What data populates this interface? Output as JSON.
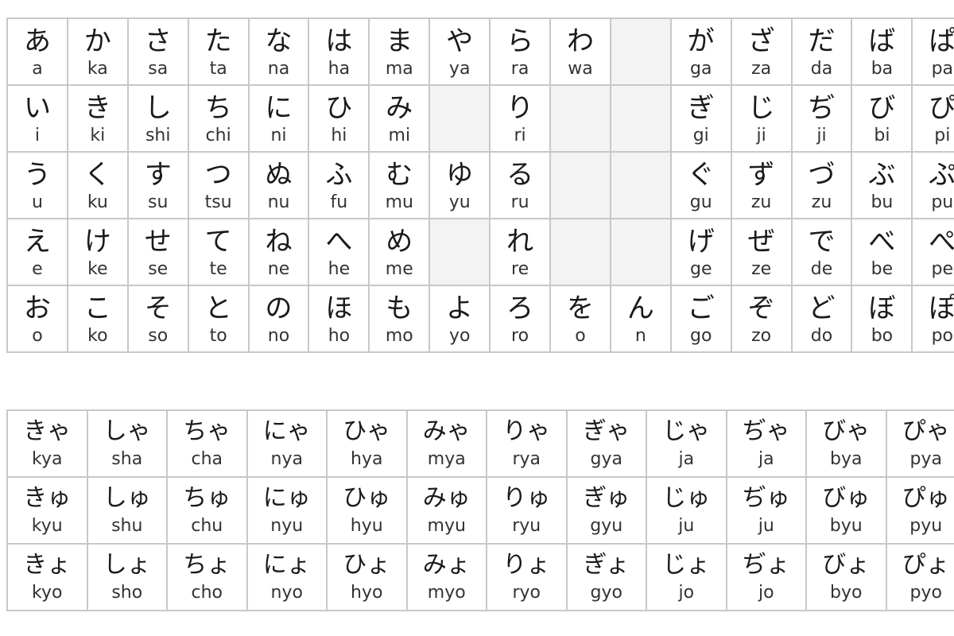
{
  "colors": {
    "border": "#c8c8c8",
    "empty_cell": "#f3f3f3",
    "text": "#222222"
  },
  "basic_table": {
    "rows": [
      [
        [
          "あ",
          "a"
        ],
        [
          "か",
          "ka"
        ],
        [
          "さ",
          "sa"
        ],
        [
          "た",
          "ta"
        ],
        [
          "な",
          "na"
        ],
        [
          "は",
          "ha"
        ],
        [
          "ま",
          "ma"
        ],
        [
          "や",
          "ya"
        ],
        [
          "ら",
          "ra"
        ],
        [
          "わ",
          "wa"
        ],
        null,
        [
          "が",
          "ga"
        ],
        [
          "ざ",
          "za"
        ],
        [
          "だ",
          "da"
        ],
        [
          "ば",
          "ba"
        ],
        [
          "ぱ",
          "pa"
        ]
      ],
      [
        [
          "い",
          "i"
        ],
        [
          "き",
          "ki"
        ],
        [
          "し",
          "shi"
        ],
        [
          "ち",
          "chi"
        ],
        [
          "に",
          "ni"
        ],
        [
          "ひ",
          "hi"
        ],
        [
          "み",
          "mi"
        ],
        null,
        [
          "り",
          "ri"
        ],
        null,
        null,
        [
          "ぎ",
          "gi"
        ],
        [
          "じ",
          "ji"
        ],
        [
          "ぢ",
          "ji"
        ],
        [
          "び",
          "bi"
        ],
        [
          "ぴ",
          "pi"
        ]
      ],
      [
        [
          "う",
          "u"
        ],
        [
          "く",
          "ku"
        ],
        [
          "す",
          "su"
        ],
        [
          "つ",
          "tsu"
        ],
        [
          "ぬ",
          "nu"
        ],
        [
          "ふ",
          "fu"
        ],
        [
          "む",
          "mu"
        ],
        [
          "ゆ",
          "yu"
        ],
        [
          "る",
          "ru"
        ],
        null,
        null,
        [
          "ぐ",
          "gu"
        ],
        [
          "ず",
          "zu"
        ],
        [
          "づ",
          "zu"
        ],
        [
          "ぶ",
          "bu"
        ],
        [
          "ぷ",
          "pu"
        ]
      ],
      [
        [
          "え",
          "e"
        ],
        [
          "け",
          "ke"
        ],
        [
          "せ",
          "se"
        ],
        [
          "て",
          "te"
        ],
        [
          "ね",
          "ne"
        ],
        [
          "へ",
          "he"
        ],
        [
          "め",
          "me"
        ],
        null,
        [
          "れ",
          "re"
        ],
        null,
        null,
        [
          "げ",
          "ge"
        ],
        [
          "ぜ",
          "ze"
        ],
        [
          "で",
          "de"
        ],
        [
          "べ",
          "be"
        ],
        [
          "ぺ",
          "pe"
        ]
      ],
      [
        [
          "お",
          "o"
        ],
        [
          "こ",
          "ko"
        ],
        [
          "そ",
          "so"
        ],
        [
          "と",
          "to"
        ],
        [
          "の",
          "no"
        ],
        [
          "ほ",
          "ho"
        ],
        [
          "も",
          "mo"
        ],
        [
          "よ",
          "yo"
        ],
        [
          "ろ",
          "ro"
        ],
        [
          "を",
          "o"
        ],
        [
          "ん",
          "n"
        ],
        [
          "ご",
          "go"
        ],
        [
          "ぞ",
          "zo"
        ],
        [
          "ど",
          "do"
        ],
        [
          "ぼ",
          "bo"
        ],
        [
          "ぽ",
          "po"
        ]
      ]
    ]
  },
  "combo_table": {
    "rows": [
      [
        [
          "きゃ",
          "kya"
        ],
        [
          "しゃ",
          "sha"
        ],
        [
          "ちゃ",
          "cha"
        ],
        [
          "にゃ",
          "nya"
        ],
        [
          "ひゃ",
          "hya"
        ],
        [
          "みゃ",
          "mya"
        ],
        [
          "りゃ",
          "rya"
        ],
        [
          "ぎゃ",
          "gya"
        ],
        [
          "じゃ",
          "ja"
        ],
        [
          "ぢゃ",
          "ja"
        ],
        [
          "びゃ",
          "bya"
        ],
        [
          "ぴゃ",
          "pya"
        ]
      ],
      [
        [
          "きゅ",
          "kyu"
        ],
        [
          "しゅ",
          "shu"
        ],
        [
          "ちゅ",
          "chu"
        ],
        [
          "にゅ",
          "nyu"
        ],
        [
          "ひゅ",
          "hyu"
        ],
        [
          "みゅ",
          "myu"
        ],
        [
          "りゅ",
          "ryu"
        ],
        [
          "ぎゅ",
          "gyu"
        ],
        [
          "じゅ",
          "ju"
        ],
        [
          "ぢゅ",
          "ju"
        ],
        [
          "びゅ",
          "byu"
        ],
        [
          "ぴゅ",
          "pyu"
        ]
      ],
      [
        [
          "きょ",
          "kyo"
        ],
        [
          "しょ",
          "sho"
        ],
        [
          "ちょ",
          "cho"
        ],
        [
          "にょ",
          "nyo"
        ],
        [
          "ひょ",
          "hyo"
        ],
        [
          "みょ",
          "myo"
        ],
        [
          "りょ",
          "ryo"
        ],
        [
          "ぎょ",
          "gyo"
        ],
        [
          "じょ",
          "jo"
        ],
        [
          "ぢょ",
          "jo"
        ],
        [
          "びょ",
          "byo"
        ],
        [
          "ぴょ",
          "pyo"
        ]
      ]
    ]
  }
}
